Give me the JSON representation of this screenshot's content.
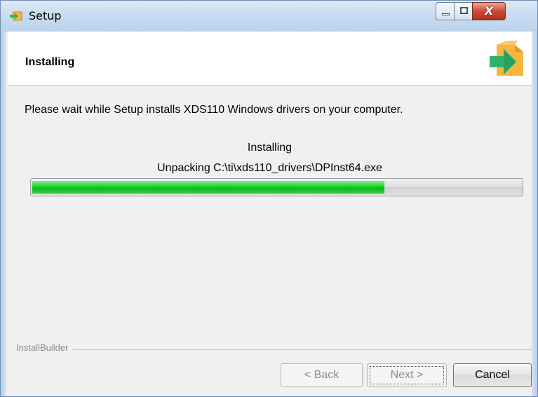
{
  "window": {
    "title": "Setup",
    "controls": {
      "minimize": "",
      "maximize": "",
      "close": "X"
    }
  },
  "header": {
    "heading": "Installing",
    "icon": "package-arrow-icon"
  },
  "content": {
    "description": "Please wait while Setup installs XDS110 Windows drivers on your computer.",
    "status_title": "Installing",
    "status_detail": "Unpacking C:\\ti\\xds110_drivers\\DPInst64.exe",
    "progress": 0.72
  },
  "footer": {
    "brand": "InstallBuilder",
    "back_label": "< Back",
    "next_label": "Next >",
    "cancel_label": "Cancel"
  },
  "colors": {
    "progress_fill": "#1ed22e",
    "title_bar": "#c9dcf0",
    "close_button": "#c9493a",
    "icon_box": "#f5b642",
    "icon_arrow": "#2fb36b"
  }
}
